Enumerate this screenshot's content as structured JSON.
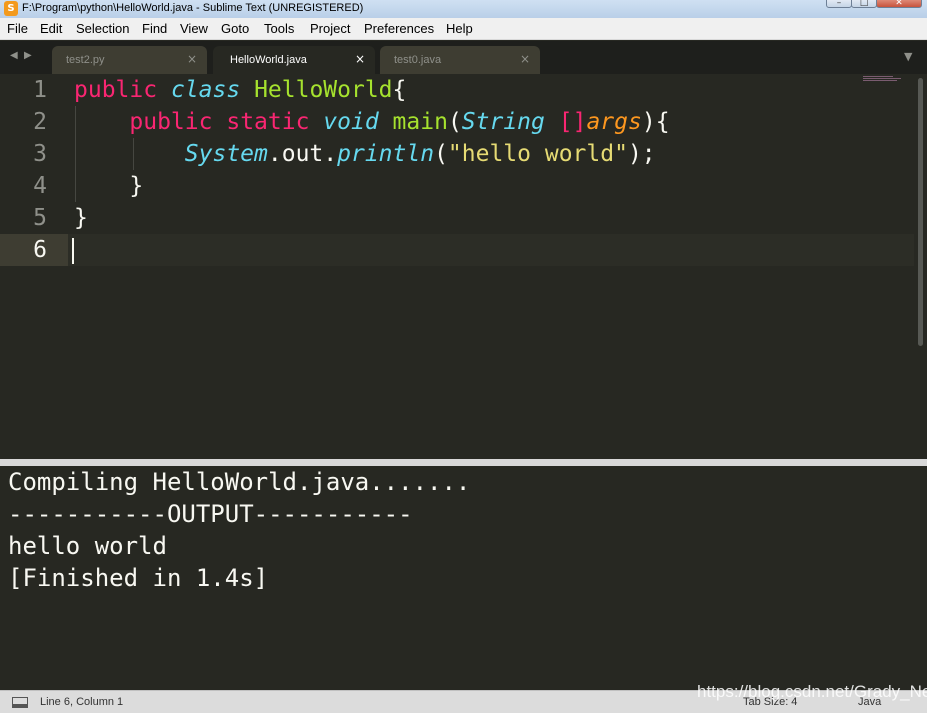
{
  "window": {
    "title": "F:\\Program\\python\\HelloWorld.java - Sublime Text (UNREGISTERED)",
    "app_icon": "sublime-logo-icon",
    "controls": {
      "minimize": "–",
      "maximize": "□",
      "close": "✕"
    }
  },
  "menu": [
    "File",
    "Edit",
    "Selection",
    "Find",
    "View",
    "Goto",
    "Tools",
    "Project",
    "Preferences",
    "Help"
  ],
  "tabs": [
    {
      "label": "test2.py",
      "active": false
    },
    {
      "label": "HelloWorld.java",
      "active": true
    },
    {
      "label": "test0.java",
      "active": false
    }
  ],
  "tab_nav": {
    "back": "◀",
    "forward": "▶",
    "dropdown": "▼",
    "close": "×"
  },
  "editor": {
    "line_numbers": [
      "1",
      "2",
      "3",
      "4",
      "5",
      "6"
    ],
    "current_line": 6,
    "lines": [
      [
        [
          "kw",
          "public"
        ],
        [
          "pl",
          " "
        ],
        [
          "ty",
          "class"
        ],
        [
          "pl",
          " "
        ],
        [
          "cls",
          "HelloWorld"
        ],
        [
          "pl",
          "{"
        ]
      ],
      [
        [
          "pl",
          "    "
        ],
        [
          "kw",
          "public"
        ],
        [
          "pl",
          " "
        ],
        [
          "kw",
          "static"
        ],
        [
          "pl",
          " "
        ],
        [
          "ty",
          "void"
        ],
        [
          "pl",
          " "
        ],
        [
          "fn",
          "main"
        ],
        [
          "pl",
          "("
        ],
        [
          "ty",
          "String"
        ],
        [
          "pl",
          " "
        ],
        [
          "kw",
          "[]"
        ],
        [
          "arg",
          "args"
        ],
        [
          "pl",
          "){"
        ]
      ],
      [
        [
          "pl",
          "        "
        ],
        [
          "ty",
          "System"
        ],
        [
          "pl",
          ".out."
        ],
        [
          "ty",
          "println"
        ],
        [
          "pl",
          "("
        ],
        [
          "str",
          "\"hello world\""
        ],
        [
          "pl",
          ");"
        ]
      ],
      [
        [
          "pl",
          "    }"
        ]
      ],
      [
        [
          "pl",
          "}"
        ]
      ],
      [
        [
          "pl",
          ""
        ]
      ]
    ]
  },
  "output": {
    "lines": [
      "Compiling HelloWorld.java.......",
      "-----------OUTPUT-----------",
      "hello world",
      "[Finished in 1.4s]"
    ]
  },
  "status": {
    "position": "Line 6, Column 1",
    "tab_size": "Tab Size: 4",
    "syntax": "Java"
  },
  "watermark": "https://blog.csdn.net/Grady_Ne",
  "colors": {
    "background": "#272822",
    "keyword": "#f92672",
    "type": "#66d9ef",
    "class_name": "#a6e22e",
    "string": "#e6db74",
    "argument": "#fd971f",
    "text": "#f8f8f2"
  }
}
